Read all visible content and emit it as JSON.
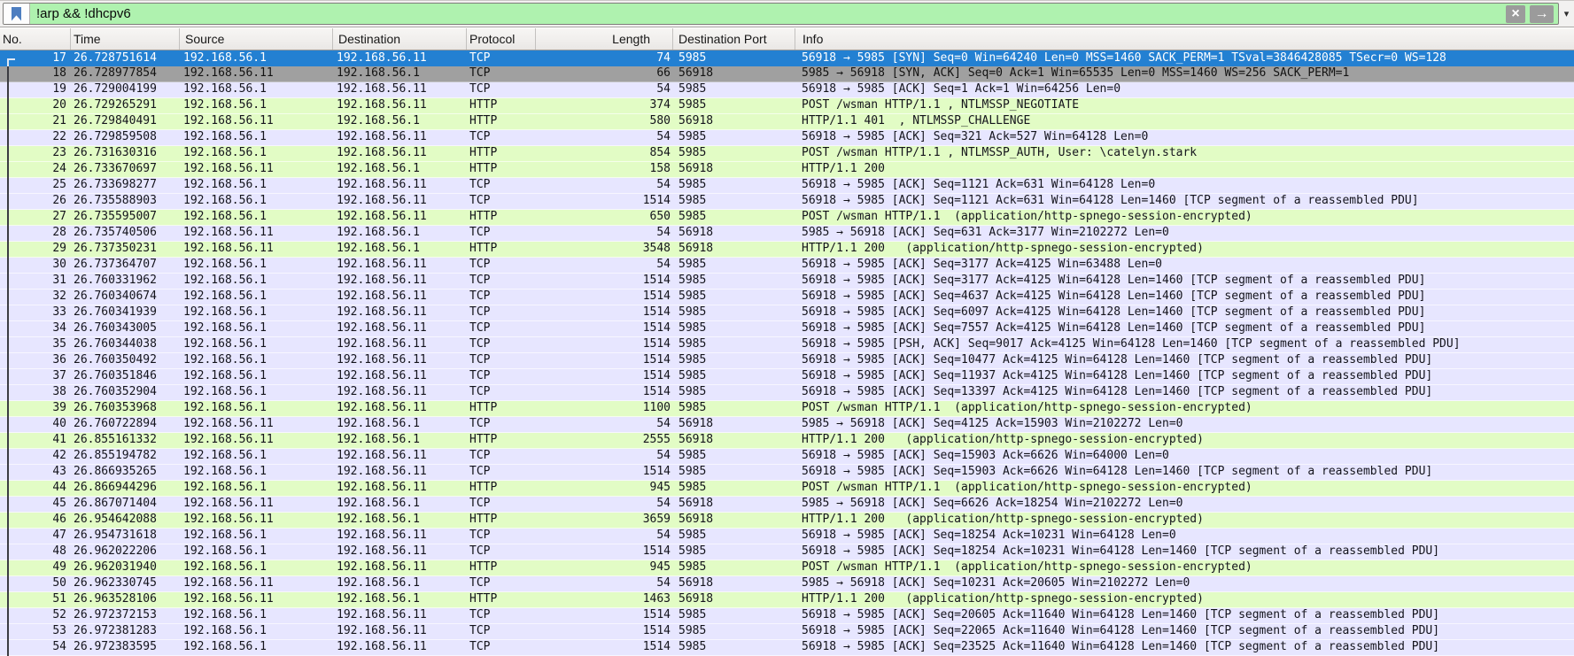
{
  "colors": {
    "filter_valid_bg": "#aff2af",
    "bookmark_blue": "#4d7ec0",
    "header_bg": "#f0eeec",
    "selected_bg": "#2380d2",
    "selected_fg": "#ffffff",
    "synfin_bg": "#a0a0a0",
    "tcp_bg": "#e7e6ff",
    "http_bg": "#e2fcc5",
    "row_fg": "#14141c"
  },
  "filter_bar": {
    "value": "!arp && !dhcpv6",
    "bookmark_icon": "bookmark",
    "clear_icon": "×",
    "apply_icon": "→",
    "dropdown_icon": "▾"
  },
  "columns": [
    {
      "id": "no",
      "label": "No."
    },
    {
      "id": "time",
      "label": "Time"
    },
    {
      "id": "source",
      "label": "Source"
    },
    {
      "id": "destination",
      "label": "Destination"
    },
    {
      "id": "protocol",
      "label": "Protocol"
    },
    {
      "id": "length",
      "label": "Length"
    },
    {
      "id": "dstport",
      "label": "Destination Port"
    },
    {
      "id": "info",
      "label": "Info"
    }
  ],
  "packets": [
    {
      "no": "17",
      "time": "26.728751614",
      "source": "192.168.56.1",
      "destination": "192.168.56.11",
      "protocol": "TCP",
      "length": "74",
      "dstport": "5985",
      "info": "56918 → 5985 [SYN] Seq=0 Win=64240 Len=0 MSS=1460 SACK_PERM=1 TSval=3846428085 TSecr=0 WS=128",
      "style": "selected"
    },
    {
      "no": "18",
      "time": "26.728977854",
      "source": "192.168.56.11",
      "destination": "192.168.56.1",
      "protocol": "TCP",
      "length": "66",
      "dstport": "56918",
      "info": "5985 → 56918 [SYN, ACK] Seq=0 Ack=1 Win=65535 Len=0 MSS=1460 WS=256 SACK_PERM=1",
      "style": "synfin"
    },
    {
      "no": "19",
      "time": "26.729004199",
      "source": "192.168.56.1",
      "destination": "192.168.56.11",
      "protocol": "TCP",
      "length": "54",
      "dstport": "5985",
      "info": "56918 → 5985 [ACK] Seq=1 Ack=1 Win=64256 Len=0",
      "style": "tcp"
    },
    {
      "no": "20",
      "time": "26.729265291",
      "source": "192.168.56.1",
      "destination": "192.168.56.11",
      "protocol": "HTTP",
      "length": "374",
      "dstport": "5985",
      "info": "POST /wsman HTTP/1.1 , NTLMSSP_NEGOTIATE",
      "style": "http"
    },
    {
      "no": "21",
      "time": "26.729840491",
      "source": "192.168.56.11",
      "destination": "192.168.56.1",
      "protocol": "HTTP",
      "length": "580",
      "dstport": "56918",
      "info": "HTTP/1.1 401  , NTLMSSP_CHALLENGE",
      "style": "http"
    },
    {
      "no": "22",
      "time": "26.729859508",
      "source": "192.168.56.1",
      "destination": "192.168.56.11",
      "protocol": "TCP",
      "length": "54",
      "dstport": "5985",
      "info": "56918 → 5985 [ACK] Seq=321 Ack=527 Win=64128 Len=0",
      "style": "tcp"
    },
    {
      "no": "23",
      "time": "26.731630316",
      "source": "192.168.56.1",
      "destination": "192.168.56.11",
      "protocol": "HTTP",
      "length": "854",
      "dstport": "5985",
      "info": "POST /wsman HTTP/1.1 , NTLMSSP_AUTH, User: \\catelyn.stark",
      "style": "http"
    },
    {
      "no": "24",
      "time": "26.733670697",
      "source": "192.168.56.11",
      "destination": "192.168.56.1",
      "protocol": "HTTP",
      "length": "158",
      "dstport": "56918",
      "info": "HTTP/1.1 200",
      "style": "http"
    },
    {
      "no": "25",
      "time": "26.733698277",
      "source": "192.168.56.1",
      "destination": "192.168.56.11",
      "protocol": "TCP",
      "length": "54",
      "dstport": "5985",
      "info": "56918 → 5985 [ACK] Seq=1121 Ack=631 Win=64128 Len=0",
      "style": "tcp"
    },
    {
      "no": "26",
      "time": "26.735588903",
      "source": "192.168.56.1",
      "destination": "192.168.56.11",
      "protocol": "TCP",
      "length": "1514",
      "dstport": "5985",
      "info": "56918 → 5985 [ACK] Seq=1121 Ack=631 Win=64128 Len=1460 [TCP segment of a reassembled PDU]",
      "style": "tcp"
    },
    {
      "no": "27",
      "time": "26.735595007",
      "source": "192.168.56.1",
      "destination": "192.168.56.11",
      "protocol": "HTTP",
      "length": "650",
      "dstport": "5985",
      "info": "POST /wsman HTTP/1.1  (application/http-spnego-session-encrypted)",
      "style": "http"
    },
    {
      "no": "28",
      "time": "26.735740506",
      "source": "192.168.56.11",
      "destination": "192.168.56.1",
      "protocol": "TCP",
      "length": "54",
      "dstport": "56918",
      "info": "5985 → 56918 [ACK] Seq=631 Ack=3177 Win=2102272 Len=0",
      "style": "tcp"
    },
    {
      "no": "29",
      "time": "26.737350231",
      "source": "192.168.56.11",
      "destination": "192.168.56.1",
      "protocol": "HTTP",
      "length": "3548",
      "dstport": "56918",
      "info": "HTTP/1.1 200   (application/http-spnego-session-encrypted)",
      "style": "http"
    },
    {
      "no": "30",
      "time": "26.737364707",
      "source": "192.168.56.1",
      "destination": "192.168.56.11",
      "protocol": "TCP",
      "length": "54",
      "dstport": "5985",
      "info": "56918 → 5985 [ACK] Seq=3177 Ack=4125 Win=63488 Len=0",
      "style": "tcp"
    },
    {
      "no": "31",
      "time": "26.760331962",
      "source": "192.168.56.1",
      "destination": "192.168.56.11",
      "protocol": "TCP",
      "length": "1514",
      "dstport": "5985",
      "info": "56918 → 5985 [ACK] Seq=3177 Ack=4125 Win=64128 Len=1460 [TCP segment of a reassembled PDU]",
      "style": "tcp"
    },
    {
      "no": "32",
      "time": "26.760340674",
      "source": "192.168.56.1",
      "destination": "192.168.56.11",
      "protocol": "TCP",
      "length": "1514",
      "dstport": "5985",
      "info": "56918 → 5985 [ACK] Seq=4637 Ack=4125 Win=64128 Len=1460 [TCP segment of a reassembled PDU]",
      "style": "tcp"
    },
    {
      "no": "33",
      "time": "26.760341939",
      "source": "192.168.56.1",
      "destination": "192.168.56.11",
      "protocol": "TCP",
      "length": "1514",
      "dstport": "5985",
      "info": "56918 → 5985 [ACK] Seq=6097 Ack=4125 Win=64128 Len=1460 [TCP segment of a reassembled PDU]",
      "style": "tcp"
    },
    {
      "no": "34",
      "time": "26.760343005",
      "source": "192.168.56.1",
      "destination": "192.168.56.11",
      "protocol": "TCP",
      "length": "1514",
      "dstport": "5985",
      "info": "56918 → 5985 [ACK] Seq=7557 Ack=4125 Win=64128 Len=1460 [TCP segment of a reassembled PDU]",
      "style": "tcp"
    },
    {
      "no": "35",
      "time": "26.760344038",
      "source": "192.168.56.1",
      "destination": "192.168.56.11",
      "protocol": "TCP",
      "length": "1514",
      "dstport": "5985",
      "info": "56918 → 5985 [PSH, ACK] Seq=9017 Ack=4125 Win=64128 Len=1460 [TCP segment of a reassembled PDU]",
      "style": "tcp"
    },
    {
      "no": "36",
      "time": "26.760350492",
      "source": "192.168.56.1",
      "destination": "192.168.56.11",
      "protocol": "TCP",
      "length": "1514",
      "dstport": "5985",
      "info": "56918 → 5985 [ACK] Seq=10477 Ack=4125 Win=64128 Len=1460 [TCP segment of a reassembled PDU]",
      "style": "tcp"
    },
    {
      "no": "37",
      "time": "26.760351846",
      "source": "192.168.56.1",
      "destination": "192.168.56.11",
      "protocol": "TCP",
      "length": "1514",
      "dstport": "5985",
      "info": "56918 → 5985 [ACK] Seq=11937 Ack=4125 Win=64128 Len=1460 [TCP segment of a reassembled PDU]",
      "style": "tcp"
    },
    {
      "no": "38",
      "time": "26.760352904",
      "source": "192.168.56.1",
      "destination": "192.168.56.11",
      "protocol": "TCP",
      "length": "1514",
      "dstport": "5985",
      "info": "56918 → 5985 [ACK] Seq=13397 Ack=4125 Win=64128 Len=1460 [TCP segment of a reassembled PDU]",
      "style": "tcp"
    },
    {
      "no": "39",
      "time": "26.760353968",
      "source": "192.168.56.1",
      "destination": "192.168.56.11",
      "protocol": "HTTP",
      "length": "1100",
      "dstport": "5985",
      "info": "POST /wsman HTTP/1.1  (application/http-spnego-session-encrypted)",
      "style": "http"
    },
    {
      "no": "40",
      "time": "26.760722894",
      "source": "192.168.56.11",
      "destination": "192.168.56.1",
      "protocol": "TCP",
      "length": "54",
      "dstport": "56918",
      "info": "5985 → 56918 [ACK] Seq=4125 Ack=15903 Win=2102272 Len=0",
      "style": "tcp"
    },
    {
      "no": "41",
      "time": "26.855161332",
      "source": "192.168.56.11",
      "destination": "192.168.56.1",
      "protocol": "HTTP",
      "length": "2555",
      "dstport": "56918",
      "info": "HTTP/1.1 200   (application/http-spnego-session-encrypted)",
      "style": "http"
    },
    {
      "no": "42",
      "time": "26.855194782",
      "source": "192.168.56.1",
      "destination": "192.168.56.11",
      "protocol": "TCP",
      "length": "54",
      "dstport": "5985",
      "info": "56918 → 5985 [ACK] Seq=15903 Ack=6626 Win=64000 Len=0",
      "style": "tcp"
    },
    {
      "no": "43",
      "time": "26.866935265",
      "source": "192.168.56.1",
      "destination": "192.168.56.11",
      "protocol": "TCP",
      "length": "1514",
      "dstport": "5985",
      "info": "56918 → 5985 [ACK] Seq=15903 Ack=6626 Win=64128 Len=1460 [TCP segment of a reassembled PDU]",
      "style": "tcp"
    },
    {
      "no": "44",
      "time": "26.866944296",
      "source": "192.168.56.1",
      "destination": "192.168.56.11",
      "protocol": "HTTP",
      "length": "945",
      "dstport": "5985",
      "info": "POST /wsman HTTP/1.1  (application/http-spnego-session-encrypted)",
      "style": "http"
    },
    {
      "no": "45",
      "time": "26.867071404",
      "source": "192.168.56.11",
      "destination": "192.168.56.1",
      "protocol": "TCP",
      "length": "54",
      "dstport": "56918",
      "info": "5985 → 56918 [ACK] Seq=6626 Ack=18254 Win=2102272 Len=0",
      "style": "tcp"
    },
    {
      "no": "46",
      "time": "26.954642088",
      "source": "192.168.56.11",
      "destination": "192.168.56.1",
      "protocol": "HTTP",
      "length": "3659",
      "dstport": "56918",
      "info": "HTTP/1.1 200   (application/http-spnego-session-encrypted)",
      "style": "http"
    },
    {
      "no": "47",
      "time": "26.954731618",
      "source": "192.168.56.1",
      "destination": "192.168.56.11",
      "protocol": "TCP",
      "length": "54",
      "dstport": "5985",
      "info": "56918 → 5985 [ACK] Seq=18254 Ack=10231 Win=64128 Len=0",
      "style": "tcp"
    },
    {
      "no": "48",
      "time": "26.962022206",
      "source": "192.168.56.1",
      "destination": "192.168.56.11",
      "protocol": "TCP",
      "length": "1514",
      "dstport": "5985",
      "info": "56918 → 5985 [ACK] Seq=18254 Ack=10231 Win=64128 Len=1460 [TCP segment of a reassembled PDU]",
      "style": "tcp"
    },
    {
      "no": "49",
      "time": "26.962031940",
      "source": "192.168.56.1",
      "destination": "192.168.56.11",
      "protocol": "HTTP",
      "length": "945",
      "dstport": "5985",
      "info": "POST /wsman HTTP/1.1  (application/http-spnego-session-encrypted)",
      "style": "http"
    },
    {
      "no": "50",
      "time": "26.962330745",
      "source": "192.168.56.11",
      "destination": "192.168.56.1",
      "protocol": "TCP",
      "length": "54",
      "dstport": "56918",
      "info": "5985 → 56918 [ACK] Seq=10231 Ack=20605 Win=2102272 Len=0",
      "style": "tcp"
    },
    {
      "no": "51",
      "time": "26.963528106",
      "source": "192.168.56.11",
      "destination": "192.168.56.1",
      "protocol": "HTTP",
      "length": "1463",
      "dstport": "56918",
      "info": "HTTP/1.1 200   (application/http-spnego-session-encrypted)",
      "style": "http"
    },
    {
      "no": "52",
      "time": "26.972372153",
      "source": "192.168.56.1",
      "destination": "192.168.56.11",
      "protocol": "TCP",
      "length": "1514",
      "dstport": "5985",
      "info": "56918 → 5985 [ACK] Seq=20605 Ack=11640 Win=64128 Len=1460 [TCP segment of a reassembled PDU]",
      "style": "tcp"
    },
    {
      "no": "53",
      "time": "26.972381283",
      "source": "192.168.56.1",
      "destination": "192.168.56.11",
      "protocol": "TCP",
      "length": "1514",
      "dstport": "5985",
      "info": "56918 → 5985 [ACK] Seq=22065 Ack=11640 Win=64128 Len=1460 [TCP segment of a reassembled PDU]",
      "style": "tcp"
    },
    {
      "no": "54",
      "time": "26.972383595",
      "source": "192.168.56.1",
      "destination": "192.168.56.11",
      "protocol": "TCP",
      "length": "1514",
      "dstport": "5985",
      "info": "56918 → 5985 [ACK] Seq=23525 Ack=11640 Win=64128 Len=1460 [TCP segment of a reassembled PDU]",
      "style": "tcp"
    }
  ]
}
